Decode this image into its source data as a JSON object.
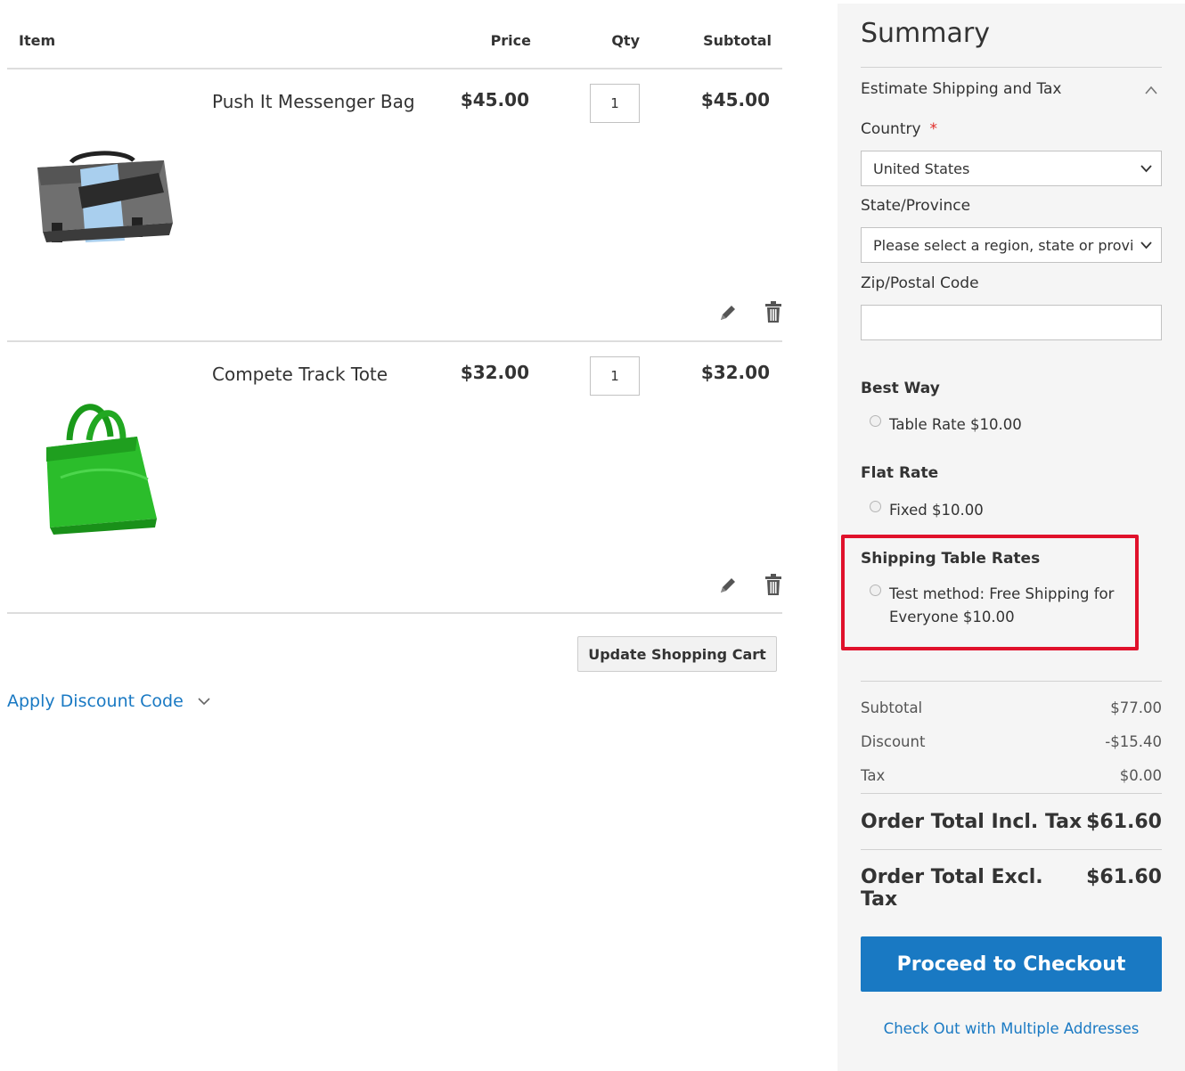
{
  "cart": {
    "headers": {
      "item": "Item",
      "price": "Price",
      "qty": "Qty",
      "subtotal": "Subtotal"
    },
    "items": [
      {
        "name": "Push It Messenger Bag",
        "price": "$45.00",
        "qty": "1",
        "subtotal": "$45.00",
        "image_icon": "messenger-bag-image"
      },
      {
        "name": "Compete Track Tote",
        "price": "$32.00",
        "qty": "1",
        "subtotal": "$32.00",
        "image_icon": "tote-bag-image"
      }
    ],
    "update_label": "Update Shopping Cart",
    "discount_label": "Apply Discount Code"
  },
  "summary": {
    "title": "Summary",
    "estimate_label": "Estimate Shipping and Tax",
    "country_label": "Country",
    "required_mark": "*",
    "country_value": "United States",
    "state_label": "State/Province",
    "state_placeholder": "Please select a region, state or province.",
    "zip_label": "Zip/Postal Code",
    "zip_value": "",
    "methods": [
      {
        "carrier": "Best Way",
        "option": "Table Rate $10.00"
      },
      {
        "carrier": "Flat Rate",
        "option": "Fixed $10.00"
      },
      {
        "carrier": "Shipping Table Rates",
        "option": "Test method: Free Shipping for Everyone $10.00"
      }
    ],
    "totals": {
      "subtotal_label": "Subtotal",
      "subtotal": "$77.00",
      "discount_label": "Discount",
      "discount": "-$15.40",
      "tax_label": "Tax",
      "tax": "$0.00",
      "incl_label": "Order Total Incl. Tax",
      "incl": "$61.60",
      "excl_label": "Order Total Excl. Tax",
      "excl": "$61.60"
    },
    "checkout_label": "Proceed to Checkout",
    "multi_label": "Check Out with Multiple Addresses"
  },
  "colors": {
    "link": "#1979c3",
    "button": "#1979c3",
    "highlight": "#e0112b",
    "panel": "#f5f5f5"
  }
}
